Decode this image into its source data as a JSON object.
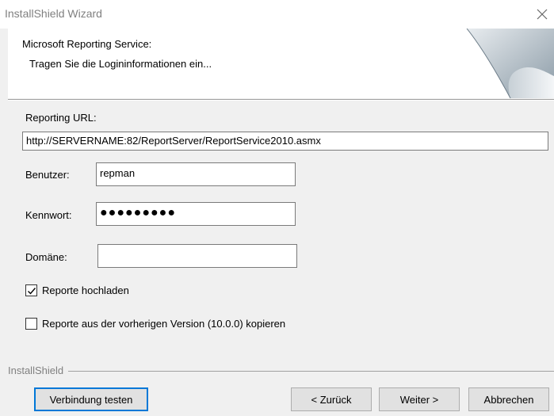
{
  "window": {
    "title": "InstallShield Wizard"
  },
  "header": {
    "title": "Microsoft Reporting Service:",
    "subtitle": "Tragen Sie die Logininformationen ein..."
  },
  "form": {
    "url_label": "Reporting URL:",
    "url_value": "http://SERVERNAME:82/ReportServer/ReportService2010.asmx",
    "user_label": "Benutzer:",
    "user_value": "repman",
    "password_label": "Kennwort:",
    "password_value": "●●●●●●●●●",
    "domain_label": "Domäne:",
    "domain_value": "",
    "upload_label": "Reporte hochladen",
    "upload_checked": true,
    "copy_label": "Reporte aus der vorherigen Version (10.0.0) kopieren",
    "copy_checked": false
  },
  "footer": {
    "group_label": "InstallShield",
    "test_button": "Verbindung testen",
    "back_button": "< Zurück",
    "next_button": "Weiter >",
    "cancel_button": "Abbrechen"
  },
  "icons": {
    "close": "close-icon",
    "check": "checkmark-icon",
    "header_art": "page-curl-icon"
  },
  "colors": {
    "window_bg": "#f0f0f0",
    "default_button_border": "#0078d7"
  }
}
